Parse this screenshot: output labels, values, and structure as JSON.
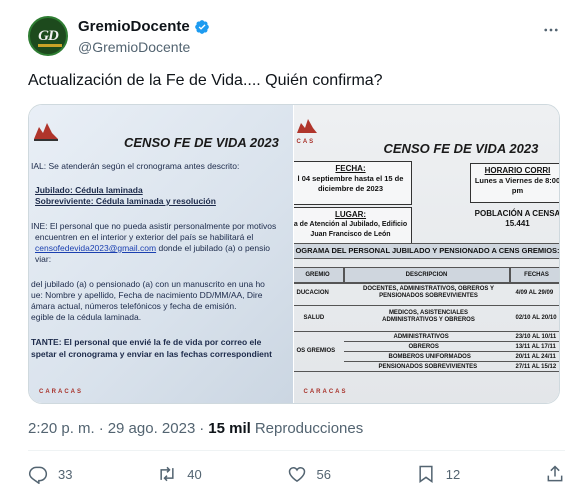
{
  "account": {
    "display_name": "GremioDocente",
    "handle": "@GremioDocente",
    "avatar_text": "GD",
    "verified_color": "#1d9bf0"
  },
  "tweet": {
    "text": "Actualización de la Fe de Vida.... Quién confirma?"
  },
  "media": {
    "left_doc": {
      "title": "CENSO FE DE VIDA 2023",
      "lines": [
        "IAL: Se atenderán según el cronograma antes descrito:",
        "Jubilado: Cédula laminada",
        "Sobreviviente: Cédula laminada y resolución",
        "INE: El personal que no pueda asistir personalmente por motivos",
        "encuentren en el interior y exterior del país se habilitará el",
        "censofedevida2023@gmail.com",
        "donde el jubilado (a) o pensio",
        "viar:",
        "del jubilado (a) o pensionado (a) con un manuscrito en una ho",
        "ue: Nombre y apellido, Fecha de nacimiento DD/MM/AA, Dire",
        "ámara actual, números telefónicos y fecha de emisión.",
        "egible de la cédula laminada.",
        "TANTE: El personal que envié la fe de vida por correo ele",
        "spetar el cronograma y enviar en las fechas correspondient"
      ],
      "footer": "CARACAS"
    },
    "right_doc": {
      "title": "CENSO FE DE VIDA 2023",
      "logo_caption": "CAS",
      "fecha_label": "FECHA:",
      "fecha_value": "l 04 septiembre hasta  el 15 de diciembre de 2023",
      "horario_label": "HORARIO CORRI",
      "horario_value": "Lunes a Viernes de 8:00 pm",
      "lugar_label": "LUGAR:",
      "lugar_value": "a de Atención al Jubilado, Edificio Juan Francisco de León",
      "poblacion_label": "POBLACIÓN A CENSA",
      "poblacion_value": "15.441",
      "programa_title": "OGRAMA DEL PERSONAL JUBILADO Y PENSIONADO  A CENS GREMIOS:",
      "col_gremio": "GREMIO",
      "col_descripcion": "DESCRIPCION",
      "col_fechas": "FECHAS",
      "rows": [
        {
          "gremio": "DUCACION",
          "descripcion": "DOCENTES, ADMINISTRATIVOS, OBREROS Y PENSIONADOS SOBREVIVIENTES",
          "fechas": "4/09 AL 29/09"
        },
        {
          "gremio": "SALUD",
          "descripcion": "MEDICOS, ASISTENCIALES ADMINISTRATIVOS Y OBREROS",
          "fechas": "02/10 AL 20/10"
        },
        {
          "gremio": "OS GREMIOS",
          "descripcion": "ADMINISTRATIVOS",
          "fechas": "23/10 AL 10/11"
        },
        {
          "gremio": "",
          "descripcion": "OBREROS",
          "fechas": "13/11 AL 17/11"
        },
        {
          "gremio": "",
          "descripcion": "BOMBEROS UNIFORMADOS",
          "fechas": "20/11 AL 24/11"
        },
        {
          "gremio": "",
          "descripcion": "PENSIONADOS SOBREVIVIENTES",
          "fechas": "27/11 AL 15/12"
        }
      ],
      "footer": "CARACAS"
    }
  },
  "meta": {
    "time": "2:20 p. m.",
    "separator": "·",
    "date": "29 ago. 2023",
    "separator2": "·",
    "views_count": "15 mil",
    "views_label": "Reproducciones"
  },
  "actions": {
    "replies": "33",
    "retweets": "40",
    "likes": "56",
    "bookmarks": "12",
    "icons": [
      "reply-icon",
      "retweet-icon",
      "like-icon",
      "bookmark-icon",
      "share-icon"
    ]
  }
}
